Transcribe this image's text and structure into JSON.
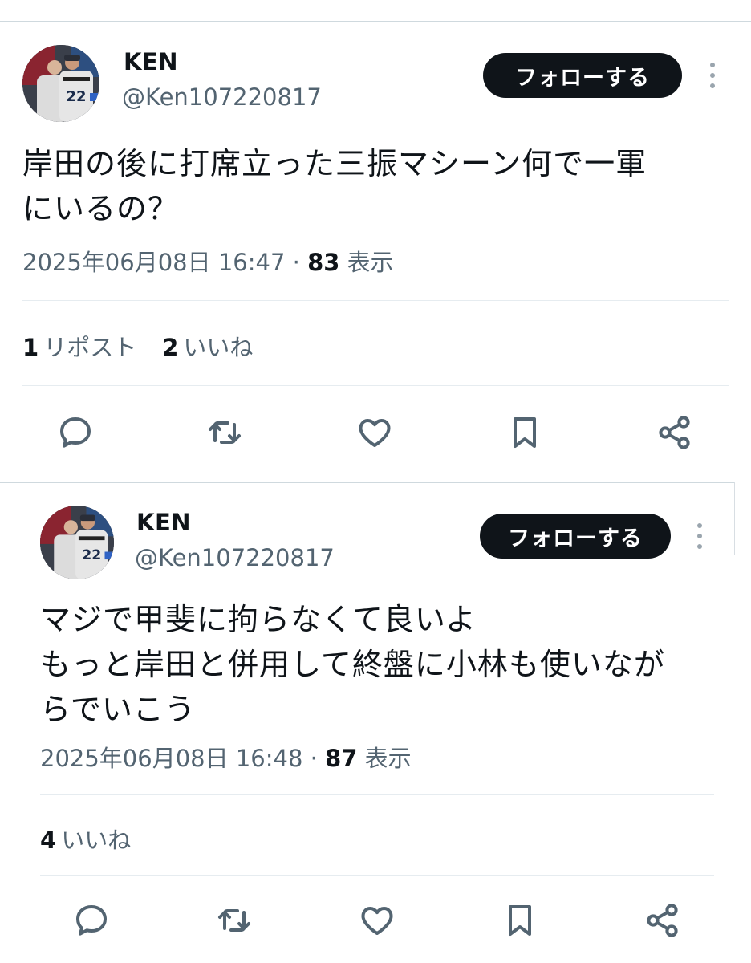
{
  "tweets": [
    {
      "name": "KEN",
      "handle": "@Ken107220817",
      "follow_label": "フォローする",
      "text_lines": [
        "岸田の後に打席立った三振マシーン何で一軍",
        "にいるの？"
      ],
      "timestamp": "2025年06月08日 16:47",
      "separator": " · ",
      "views_count": "83",
      "views_label": " 表示",
      "reposts_count": "1",
      "reposts_label": "リポスト",
      "likes_count": "2",
      "likes_label": "いいね",
      "avatar_jersey": "22",
      "icons": [
        "reply-icon",
        "repost-icon",
        "like-icon",
        "bookmark-icon",
        "share-icon"
      ]
    },
    {
      "name": "KEN",
      "handle": "@Ken107220817",
      "follow_label": "フォローする",
      "text_lines": [
        "マジで甲斐に拘らなくて良いよ",
        "もっと岸田と併用して終盤に小林も使いなが",
        "らでいこう"
      ],
      "timestamp": "2025年06月08日 16:48",
      "separator": " · ",
      "views_count": "87",
      "views_label": " 表示",
      "likes_count": "4",
      "likes_label": "いいね",
      "avatar_jersey": "22",
      "icons": [
        "reply-icon",
        "repost-icon",
        "like-icon",
        "bookmark-icon",
        "share-icon"
      ]
    }
  ],
  "colors": {
    "text_primary": "#0f1419",
    "text_secondary": "#536471",
    "divider": "#e6ecf0",
    "button_bg": "#0f1419",
    "button_text": "#ffffff"
  }
}
